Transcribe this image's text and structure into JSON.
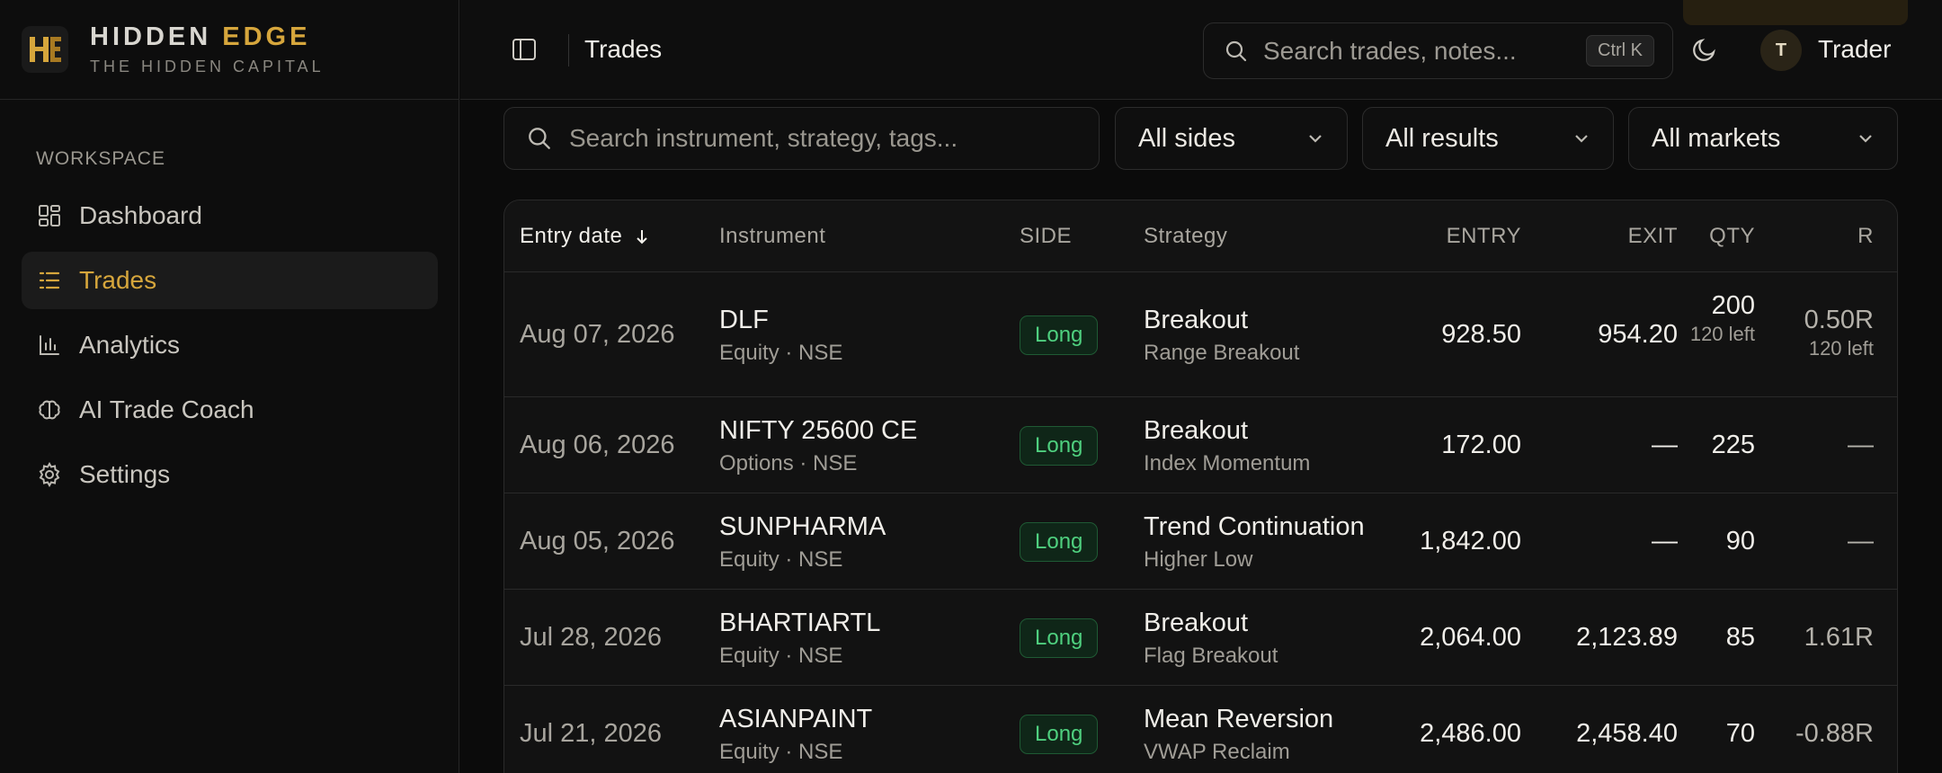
{
  "brand": {
    "name_main": "HIDDEN",
    "name_accent": "EDGE",
    "tagline": "THE HIDDEN CAPITAL"
  },
  "sidebar": {
    "section": "WORKSPACE",
    "items": [
      {
        "label": "Dashboard",
        "icon": "dashboard-icon"
      },
      {
        "label": "Trades",
        "icon": "list-icon",
        "active": true
      },
      {
        "label": "Analytics",
        "icon": "bar-chart-icon"
      },
      {
        "label": "AI Trade Coach",
        "icon": "brain-icon"
      },
      {
        "label": "Settings",
        "icon": "gear-icon"
      }
    ]
  },
  "topbar": {
    "breadcrumb": "Trades",
    "search_placeholder": "Search trades, notes...",
    "shortcut": "Ctrl K",
    "avatar_initial": "T",
    "user_name": "Trader"
  },
  "filters": {
    "search_placeholder": "Search instrument, strategy, tags...",
    "sides": "All sides",
    "results": "All results",
    "markets": "All markets"
  },
  "table": {
    "headers": {
      "entry_date": "Entry date",
      "instrument": "Instrument",
      "side": "SIDE",
      "strategy": "Strategy",
      "entry": "ENTRY",
      "exit": "EXIT",
      "qty": "QTY",
      "r": "R"
    },
    "rows": [
      {
        "date": "Aug 07, 2026",
        "symbol": "DLF",
        "market": "Equity · NSE",
        "side": "Long",
        "strategy": "Breakout",
        "setup": "Range Breakout",
        "entry": "928.50",
        "exit": "954.20",
        "qty": "200",
        "qty_sub": "120 left",
        "r": "0.50R",
        "r_sub": "120 left"
      },
      {
        "date": "Aug 06, 2026",
        "symbol": "NIFTY 25600 CE",
        "market": "Options · NSE",
        "side": "Long",
        "strategy": "Breakout",
        "setup": "Index Momentum",
        "entry": "172.00",
        "exit": "—",
        "qty": "225",
        "qty_sub": "",
        "r": "—",
        "r_sub": ""
      },
      {
        "date": "Aug 05, 2026",
        "symbol": "SUNPHARMA",
        "market": "Equity · NSE",
        "side": "Long",
        "strategy": "Trend Continuation",
        "setup": "Higher Low",
        "entry": "1,842.00",
        "exit": "—",
        "qty": "90",
        "qty_sub": "",
        "r": "—",
        "r_sub": ""
      },
      {
        "date": "Jul 28, 2026",
        "symbol": "BHARTIARTL",
        "market": "Equity · NSE",
        "side": "Long",
        "strategy": "Breakout",
        "setup": "Flag Breakout",
        "entry": "2,064.00",
        "exit": "2,123.89",
        "qty": "85",
        "qty_sub": "",
        "r": "1.61R",
        "r_sub": ""
      },
      {
        "date": "Jul 21, 2026",
        "symbol": "ASIANPAINT",
        "market": "Equity · NSE",
        "side": "Long",
        "strategy": "Mean Reversion",
        "setup": "VWAP Reclaim",
        "entry": "2,486.00",
        "exit": "2,458.40",
        "qty": "70",
        "qty_sub": "",
        "r": "-0.88R",
        "r_sub": ""
      }
    ]
  }
}
